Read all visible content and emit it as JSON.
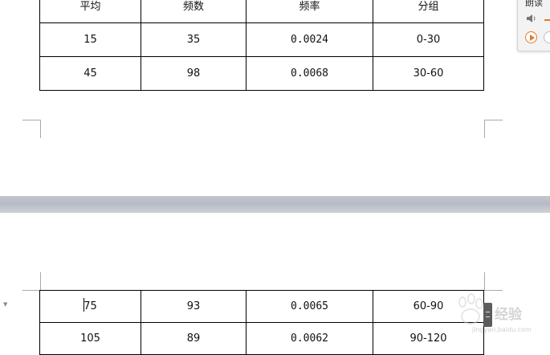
{
  "table_top": {
    "header": [
      "平均",
      "频数",
      "频率",
      "分组"
    ],
    "rows": [
      [
        "15",
        "35",
        "0.0024",
        "0-30"
      ],
      [
        "45",
        "98",
        "0.0068",
        "30-60"
      ]
    ]
  },
  "table_bottom": {
    "rows": [
      [
        "75",
        "93",
        "0.0065",
        "60-90"
      ],
      [
        "105",
        "89",
        "0.0062",
        "90-120"
      ]
    ]
  },
  "read_panel": {
    "title": "朗读",
    "accent_color": "#e07a2c",
    "icons": [
      "speaker-icon",
      "play-icon",
      "stop-icon"
    ]
  },
  "watermark": {
    "text": "经验",
    "url": "jingyan.baidu.com"
  },
  "colors": {
    "page_gap": "#bfc1ca",
    "border": "#000000",
    "corner_mark": "#a9a9a9"
  }
}
